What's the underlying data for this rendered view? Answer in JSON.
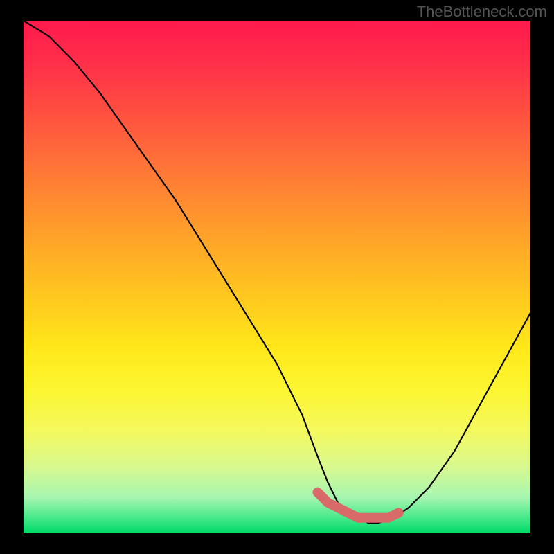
{
  "watermark": "TheBottleneck.com",
  "chart_data": {
    "type": "line",
    "title": "",
    "xlabel": "",
    "ylabel": "",
    "xlim": [
      0,
      100
    ],
    "ylim": [
      0,
      100
    ],
    "series": [
      {
        "name": "bottleneck-curve",
        "x": [
          0,
          5,
          10,
          15,
          20,
          25,
          30,
          35,
          40,
          45,
          50,
          55,
          58,
          60,
          62,
          64,
          66,
          68,
          70,
          73,
          76,
          80,
          85,
          90,
          95,
          100
        ],
        "values": [
          100,
          97,
          92,
          86,
          79,
          72,
          65,
          57,
          49,
          41,
          33,
          23,
          15,
          10,
          6,
          4,
          3,
          2,
          2,
          3,
          5,
          9,
          16,
          25,
          34,
          43
        ]
      },
      {
        "name": "highlight-band",
        "x": [
          58,
          60,
          62,
          64,
          66,
          68,
          70,
          72,
          74
        ],
        "values": [
          8,
          6,
          5,
          4,
          3,
          3,
          3,
          3,
          4
        ]
      }
    ],
    "highlight_color": "#d96a6a",
    "curve_color": "#000000",
    "gradient_stops": [
      {
        "pos": 0,
        "color": "#ff1a4d"
      },
      {
        "pos": 18,
        "color": "#ff5040"
      },
      {
        "pos": 42,
        "color": "#ffa229"
      },
      {
        "pos": 64,
        "color": "#ffe81a"
      },
      {
        "pos": 87,
        "color": "#d8f98f"
      },
      {
        "pos": 100,
        "color": "#00d968"
      }
    ]
  }
}
